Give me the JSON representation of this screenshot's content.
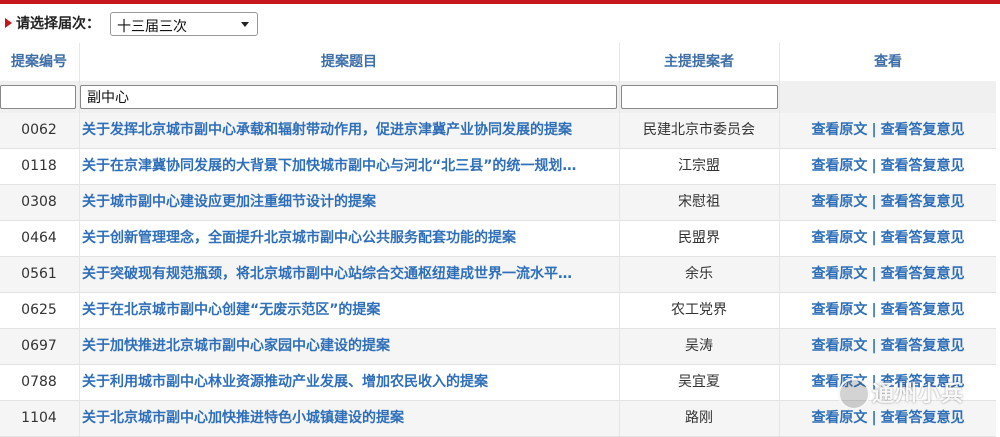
{
  "session": {
    "label": "请选择届次：",
    "selected": "十三届三次"
  },
  "table": {
    "headers": {
      "id": "提案编号",
      "title": "提案题目",
      "author": "主提提案者",
      "actions": "查看"
    },
    "filters": {
      "id": "",
      "title": "副中心",
      "author": ""
    },
    "action_labels": {
      "original": "查看原文",
      "separator": "|",
      "reply": "查看答复意见"
    },
    "rows": [
      {
        "id": "0062",
        "title": "关于发挥北京城市副中心承载和辐射带动作用，促进京津冀产业协同发展的提案",
        "author": "民建北京市委员会"
      },
      {
        "id": "0118",
        "title": "关于在京津冀协同发展的大背景下加快城市副中心与河北“北三县”的统一规划…",
        "author": "江宗盟"
      },
      {
        "id": "0308",
        "title": "关于城市副中心建设应更加注重细节设计的提案",
        "author": "宋慰祖"
      },
      {
        "id": "0464",
        "title": "关于创新管理理念，全面提升北京城市副中心公共服务配套功能的提案",
        "author": "民盟界"
      },
      {
        "id": "0561",
        "title": "关于突破现有规范瓶颈，将北京城市副中心站综合交通枢纽建成世界一流水平…",
        "author": "余乐"
      },
      {
        "id": "0625",
        "title": "关于在北京城市副中心创建“无废示范区”的提案",
        "author": "农工党界"
      },
      {
        "id": "0697",
        "title": "关于加快推进北京城市副中心家园中心建设的提案",
        "author": "吴涛"
      },
      {
        "id": "0788",
        "title": "关于利用城市副中心林业资源推动产业发展、增加农民收入的提案",
        "author": "吴宜夏"
      },
      {
        "id": "1104",
        "title": "关于北京城市副中心加快推进特色小城镇建设的提案",
        "author": "路刚"
      }
    ]
  },
  "watermark": {
    "text": "通州小兵"
  }
}
